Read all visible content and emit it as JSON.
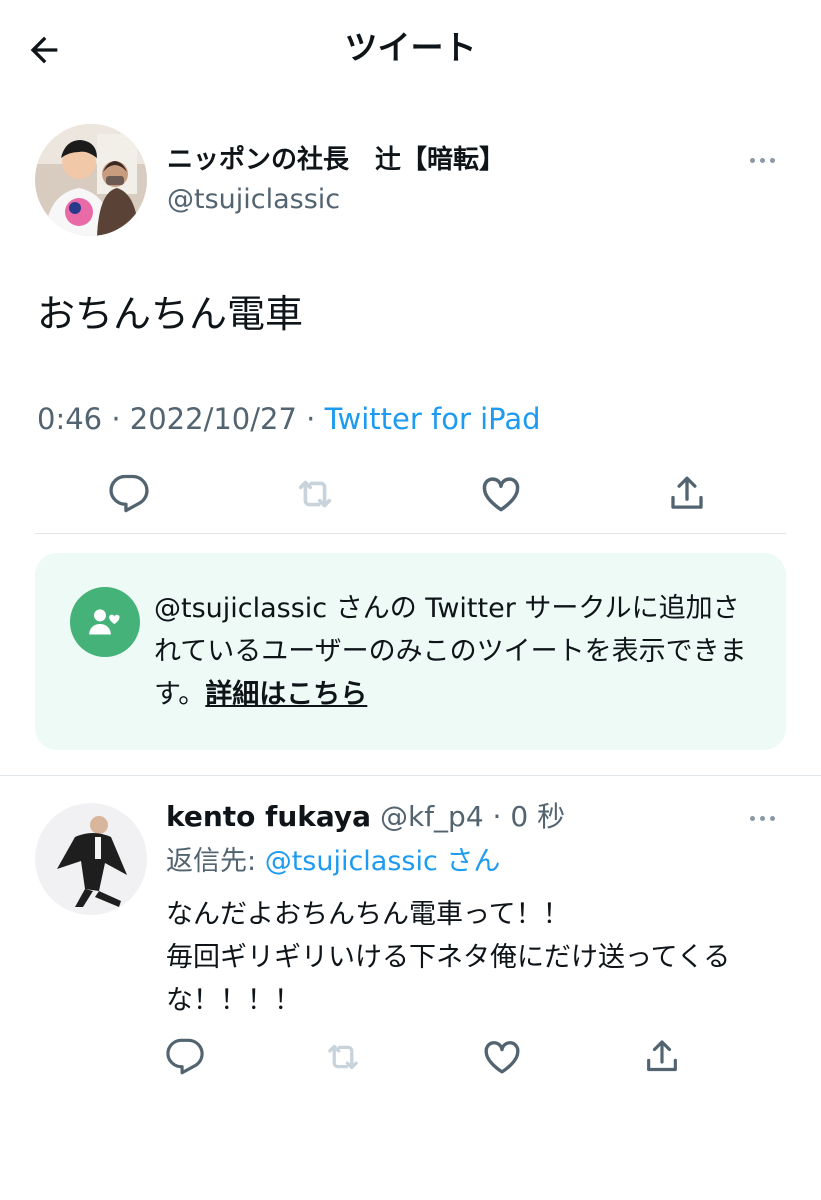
{
  "header": {
    "title": "ツイート",
    "back_icon": "arrow-left-icon"
  },
  "tweet": {
    "author_name": "ニッポンの社長　辻【暗転】",
    "author_handle": "@tsujiclassic",
    "text": "おちんちん電車",
    "time": "0:46",
    "date": "2022/10/27",
    "source": "Twitter for iPad"
  },
  "circle_notice": {
    "text": "@tsujiclassic さんの Twitter サークルに追加されているユーザーのみこのツイートを表示できます。",
    "link": "詳細はこちら",
    "icon_color": "#45b27a",
    "background": "#eefaf5"
  },
  "reply": {
    "author_name": "kento fukaya",
    "author_handle": "@kf_p4",
    "time": "0 秒",
    "reply_to_label": "返信先: ",
    "reply_to_handle": "@tsujiclassic",
    "reply_to_suffix": " さん",
    "text": "なんだよおちんちん電車って！！\n毎回ギリギリいける下ネタ俺にだけ送ってくるな！！！！"
  },
  "colors": {
    "link": "#1d9bf0",
    "muted": "#536471",
    "text": "#0f1419"
  }
}
